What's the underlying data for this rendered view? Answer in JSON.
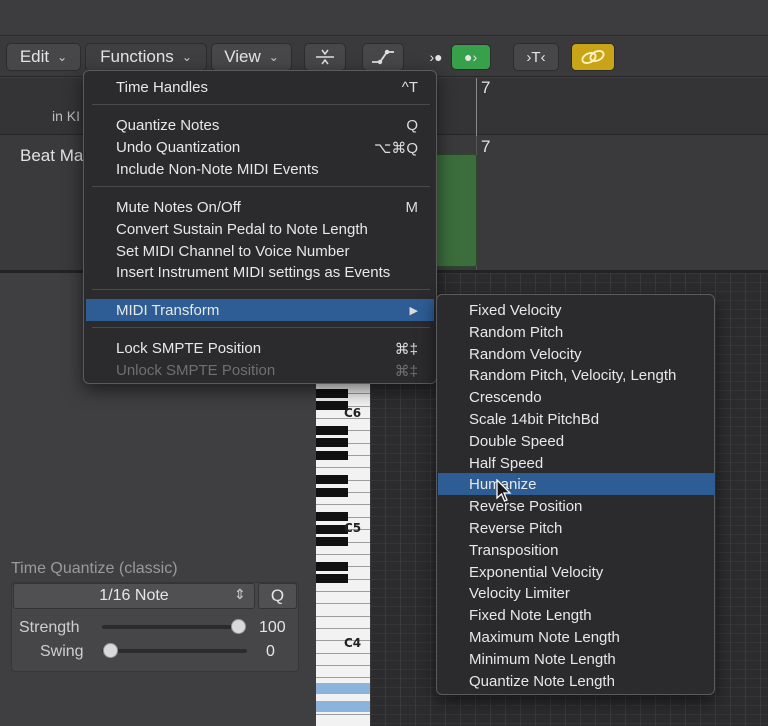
{
  "toolbar": {
    "edit_label": "Edit",
    "functions_label": "Functions",
    "view_label": "View"
  },
  "ruler": {
    "bar_number": "7",
    "bar_number_2": "7",
    "left_label": "in KI",
    "track_name": "Beat Ma"
  },
  "functions_menu": {
    "items": [
      {
        "label": "Time Handles",
        "shortcut": "^T"
      },
      {
        "label": "Quantize Notes",
        "shortcut": "Q"
      },
      {
        "label": "Undo Quantization",
        "shortcut": "⌥⌘Q"
      },
      {
        "label": "Include Non-Note MIDI Events",
        "shortcut": ""
      },
      {
        "label": "Mute Notes On/Off",
        "shortcut": "M"
      },
      {
        "label": "Convert Sustain Pedal to Note Length",
        "shortcut": ""
      },
      {
        "label": "Set MIDI Channel to Voice Number",
        "shortcut": ""
      },
      {
        "label": "Insert Instrument MIDI settings as Events",
        "shortcut": ""
      },
      {
        "label": "MIDI Transform",
        "shortcut": "▶"
      },
      {
        "label": "Lock SMPTE Position",
        "shortcut": "⌘‡"
      },
      {
        "label": "Unlock SMPTE Position",
        "shortcut": "⌘‡"
      }
    ]
  },
  "midi_transform_menu": {
    "items": [
      "Fixed Velocity",
      "Random Pitch",
      "Random Velocity",
      "Random Pitch, Velocity, Length",
      "Crescendo",
      "Scale 14bit PitchBd",
      "Double Speed",
      "Half Speed",
      "Humanize",
      "Reverse Position",
      "Reverse Pitch",
      "Transposition",
      "Exponential Velocity",
      "Velocity Limiter",
      "Fixed Note Length",
      "Maximum Note Length",
      "Minimum Note Length",
      "Quantize Note Length"
    ],
    "highlighted": "Humanize"
  },
  "time_quantize": {
    "title": "Time Quantize (classic)",
    "value": "1/16 Note",
    "q_label": "Q",
    "strength_label": "Strength",
    "strength_value": "100",
    "swing_label": "Swing",
    "swing_value": "0"
  },
  "piano": {
    "labels": [
      "C6",
      "C5",
      "C4"
    ]
  },
  "colors": {
    "menu_highlight": "#2e5d95",
    "region_green": "#3c6d3d",
    "midi_button_green": "#37a04a",
    "link_button_yellow": "#c9a418"
  }
}
